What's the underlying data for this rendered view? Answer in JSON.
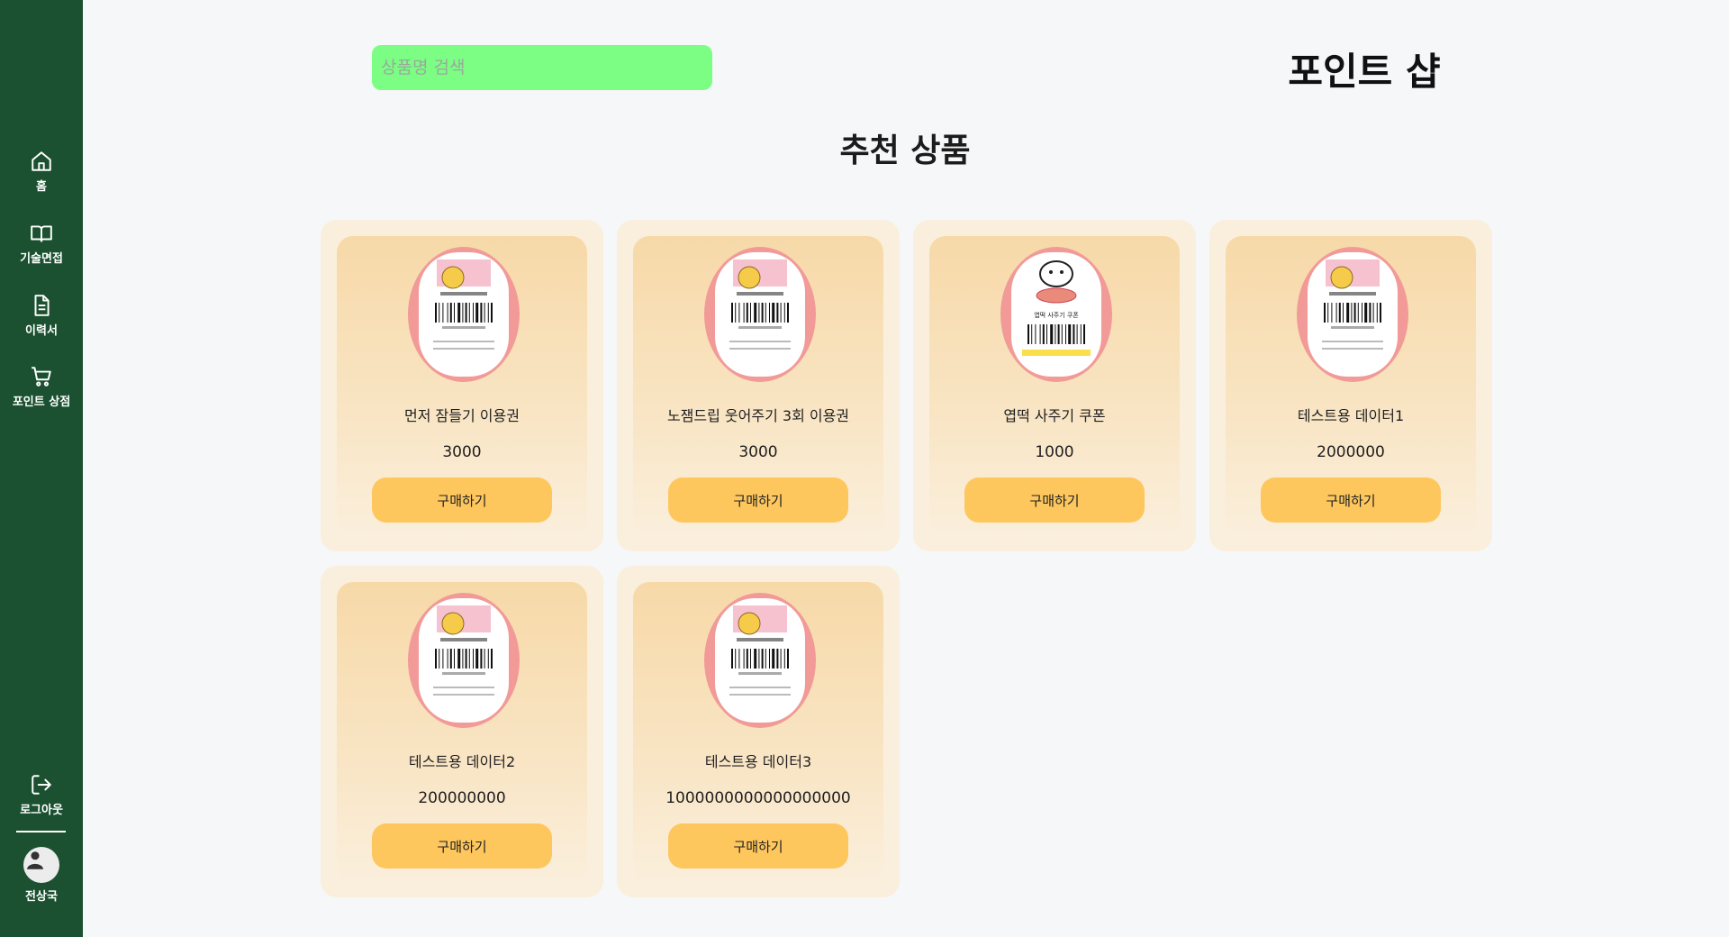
{
  "sidebar": {
    "items": [
      {
        "label": "홈",
        "icon": "home-icon"
      },
      {
        "label": "기술면접",
        "icon": "book-icon"
      },
      {
        "label": "이력서",
        "icon": "document-icon"
      },
      {
        "label": "포인트 상점",
        "icon": "cart-icon"
      }
    ],
    "logout": {
      "label": "로그아웃",
      "icon": "logout-icon"
    },
    "user": {
      "name": "전상국",
      "icon": "avatar-icon"
    }
  },
  "header": {
    "search_placeholder": "상품명 검색",
    "title": "포인트 샵"
  },
  "section": {
    "title": "추천 상품"
  },
  "products": [
    {
      "name": "먼저 잠들기 이용권",
      "price": "3000",
      "button": "구매하기"
    },
    {
      "name": "노잼드립 웃어주기 3회 이용권",
      "price": "3000",
      "button": "구매하기"
    },
    {
      "name": "엽떡 사주기 쿠폰",
      "price": "1000",
      "button": "구매하기"
    },
    {
      "name": "테스트용 데이터1",
      "price": "2000000",
      "button": "구매하기"
    },
    {
      "name": "테스트용 데이터2",
      "price": "200000000",
      "button": "구매하기"
    },
    {
      "name": "테스트용 데이터3",
      "price": "1000000000000000000",
      "button": "구매하기"
    }
  ],
  "colors": {
    "sidebar": "#1b5130",
    "search": "#7cfe85",
    "card": "#faefdc",
    "button": "#fec75d"
  }
}
